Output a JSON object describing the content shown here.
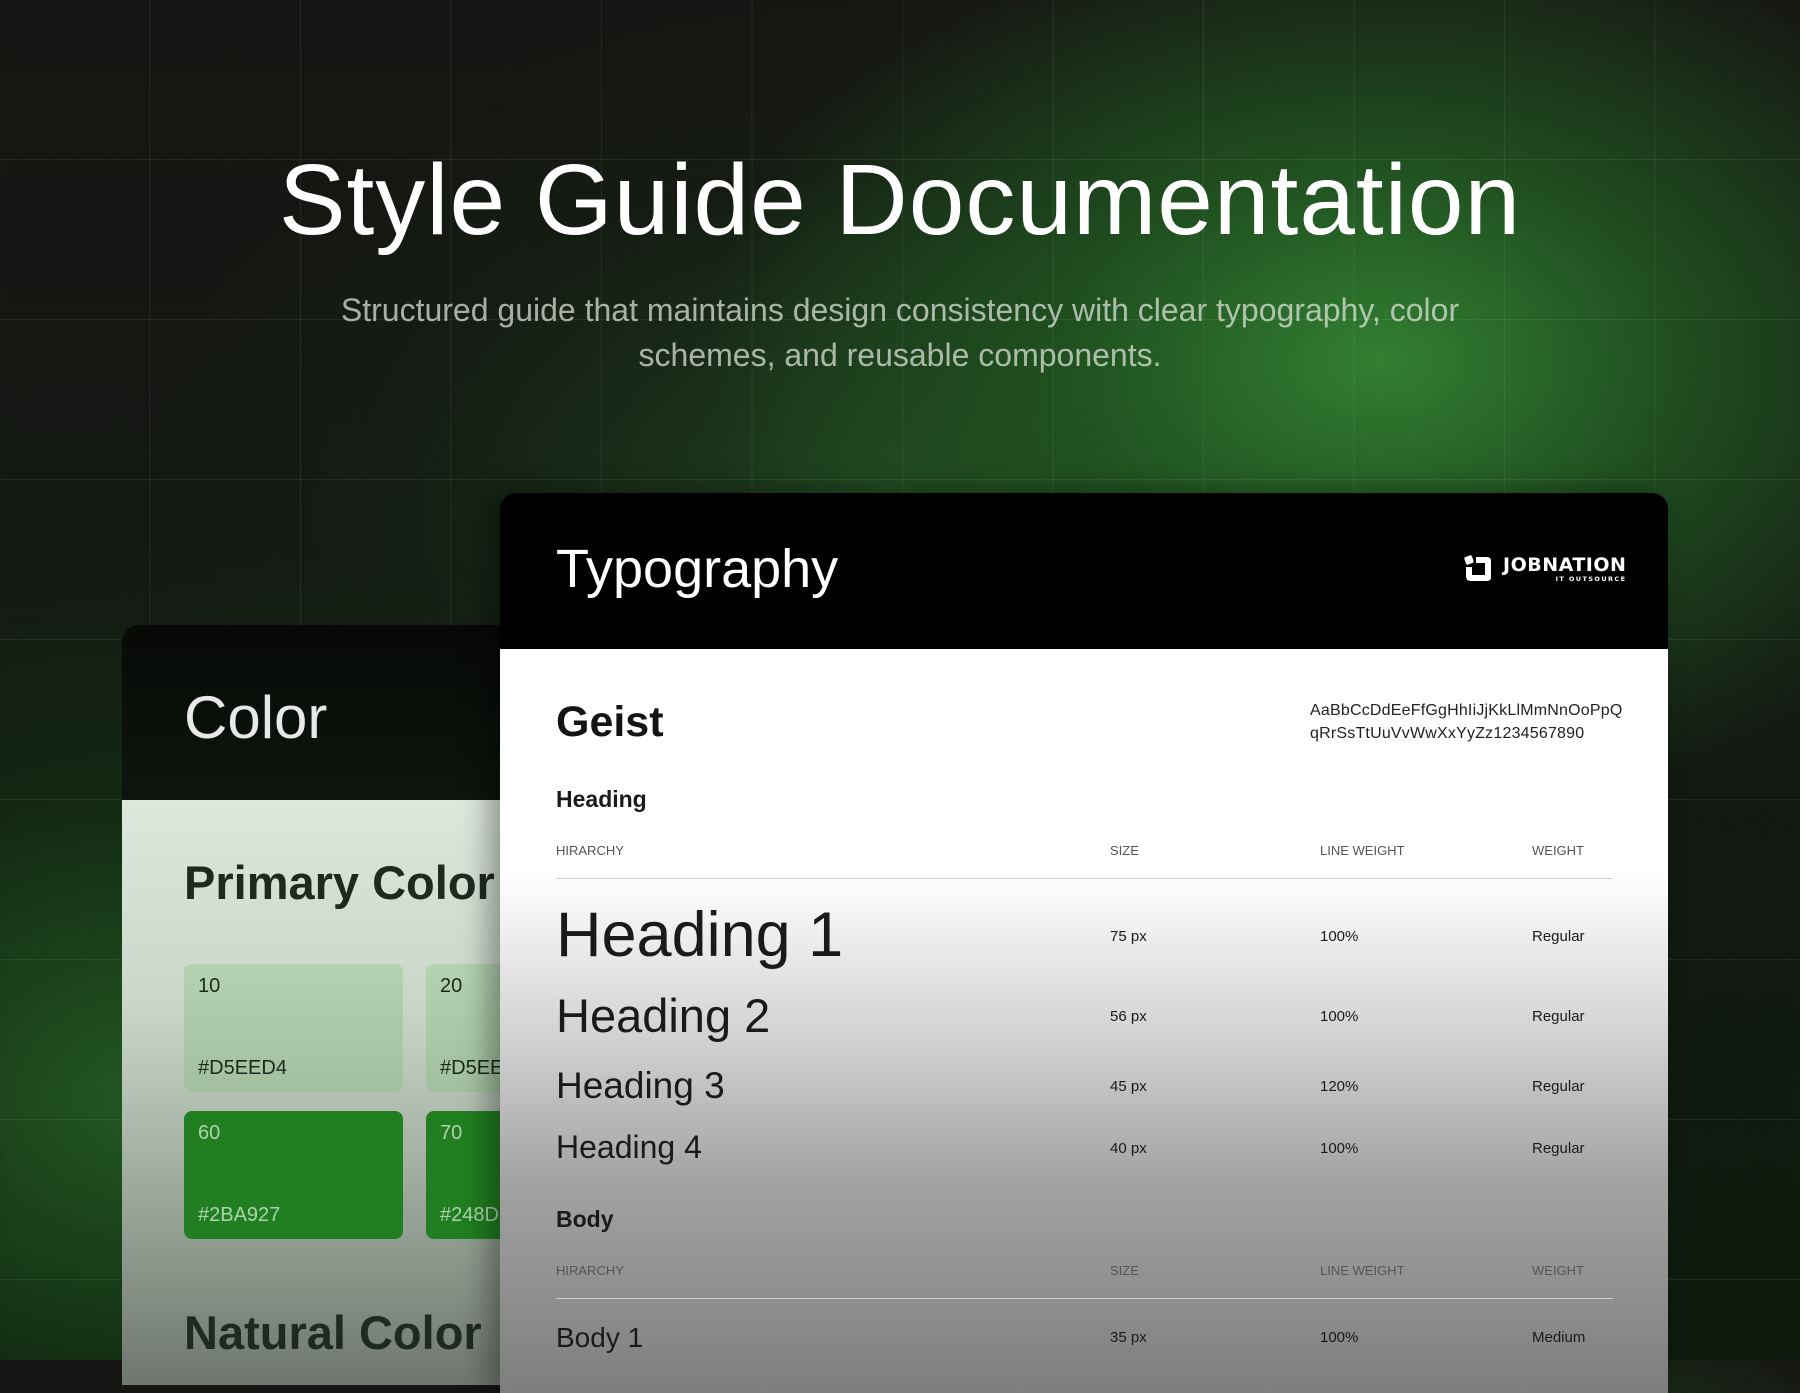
{
  "hero": {
    "title": "Style Guide Documentation",
    "subtitle": "Structured guide that maintains design consistency with clear typography, color schemes, and reusable components."
  },
  "color_card": {
    "title": "Color",
    "primary_title": "Primary Color",
    "natural_title": "Natural Color",
    "swatches": [
      {
        "step": "10",
        "hex": "#D5EED4",
        "tone": "light"
      },
      {
        "step": "20",
        "hex": "#D5EE",
        "tone": "light"
      },
      {
        "step": "60",
        "hex": "#2BA927",
        "tone": "dark"
      },
      {
        "step": "70",
        "hex": "#248D",
        "tone": "dark"
      }
    ]
  },
  "typography_card": {
    "title": "Typography",
    "logo": {
      "name": "JOBNATION",
      "sub": "IT OUTSOURCE",
      "icon": "jobnation-logo-icon"
    },
    "font_name": "Geist",
    "alphabet": "AaBbCcDdEeFfGgHhIiJjKkLlMmNnOoPpQqRrSsTtUuVvWwXxYyZz1234567890",
    "columns": {
      "hierarchy": "HIRARCHY",
      "size": "SIZE",
      "line_weight": "LINE WEIGHT",
      "weight": "WEIGHT"
    },
    "heading_group": {
      "title": "Heading",
      "rows": [
        {
          "name": "Heading 1",
          "size": "75 px",
          "line": "100%",
          "weight": "Regular"
        },
        {
          "name": "Heading 2",
          "size": "56 px",
          "line": "100%",
          "weight": "Regular"
        },
        {
          "name": "Heading 3",
          "size": "45 px",
          "line": "120%",
          "weight": "Regular"
        },
        {
          "name": "Heading 4",
          "size": "40 px",
          "line": "100%",
          "weight": "Regular"
        }
      ]
    },
    "body_group": {
      "title": "Body",
      "rows": [
        {
          "name": "Body 1",
          "size": "35 px",
          "line": "100%",
          "weight": "Medium"
        }
      ]
    }
  }
}
